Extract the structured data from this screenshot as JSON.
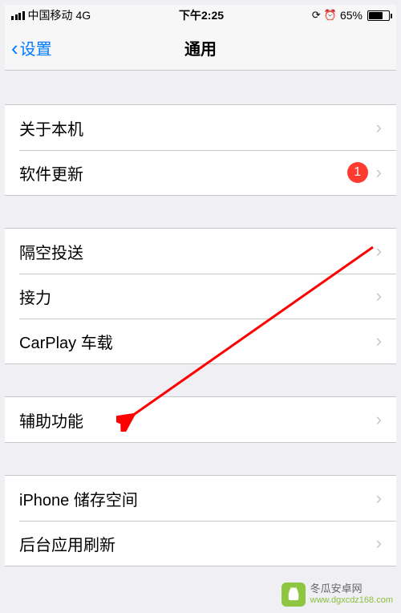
{
  "status_bar": {
    "carrier": "中国移动",
    "network": "4G",
    "time": "下午2:25",
    "battery_pct": "65%"
  },
  "nav": {
    "back_label": "设置",
    "title": "通用"
  },
  "groups": {
    "g1": {
      "about": "关于本机",
      "update": "软件更新",
      "update_badge": "1"
    },
    "g2": {
      "airdrop": "隔空投送",
      "handoff": "接力",
      "carplay": "CarPlay 车载"
    },
    "g3": {
      "accessibility": "辅助功能"
    },
    "g4": {
      "storage": "iPhone 储存空间",
      "background_refresh": "后台应用刷新"
    }
  },
  "watermark": {
    "line1": "冬瓜安卓网",
    "line2": "www.dgxcdz168.com"
  }
}
